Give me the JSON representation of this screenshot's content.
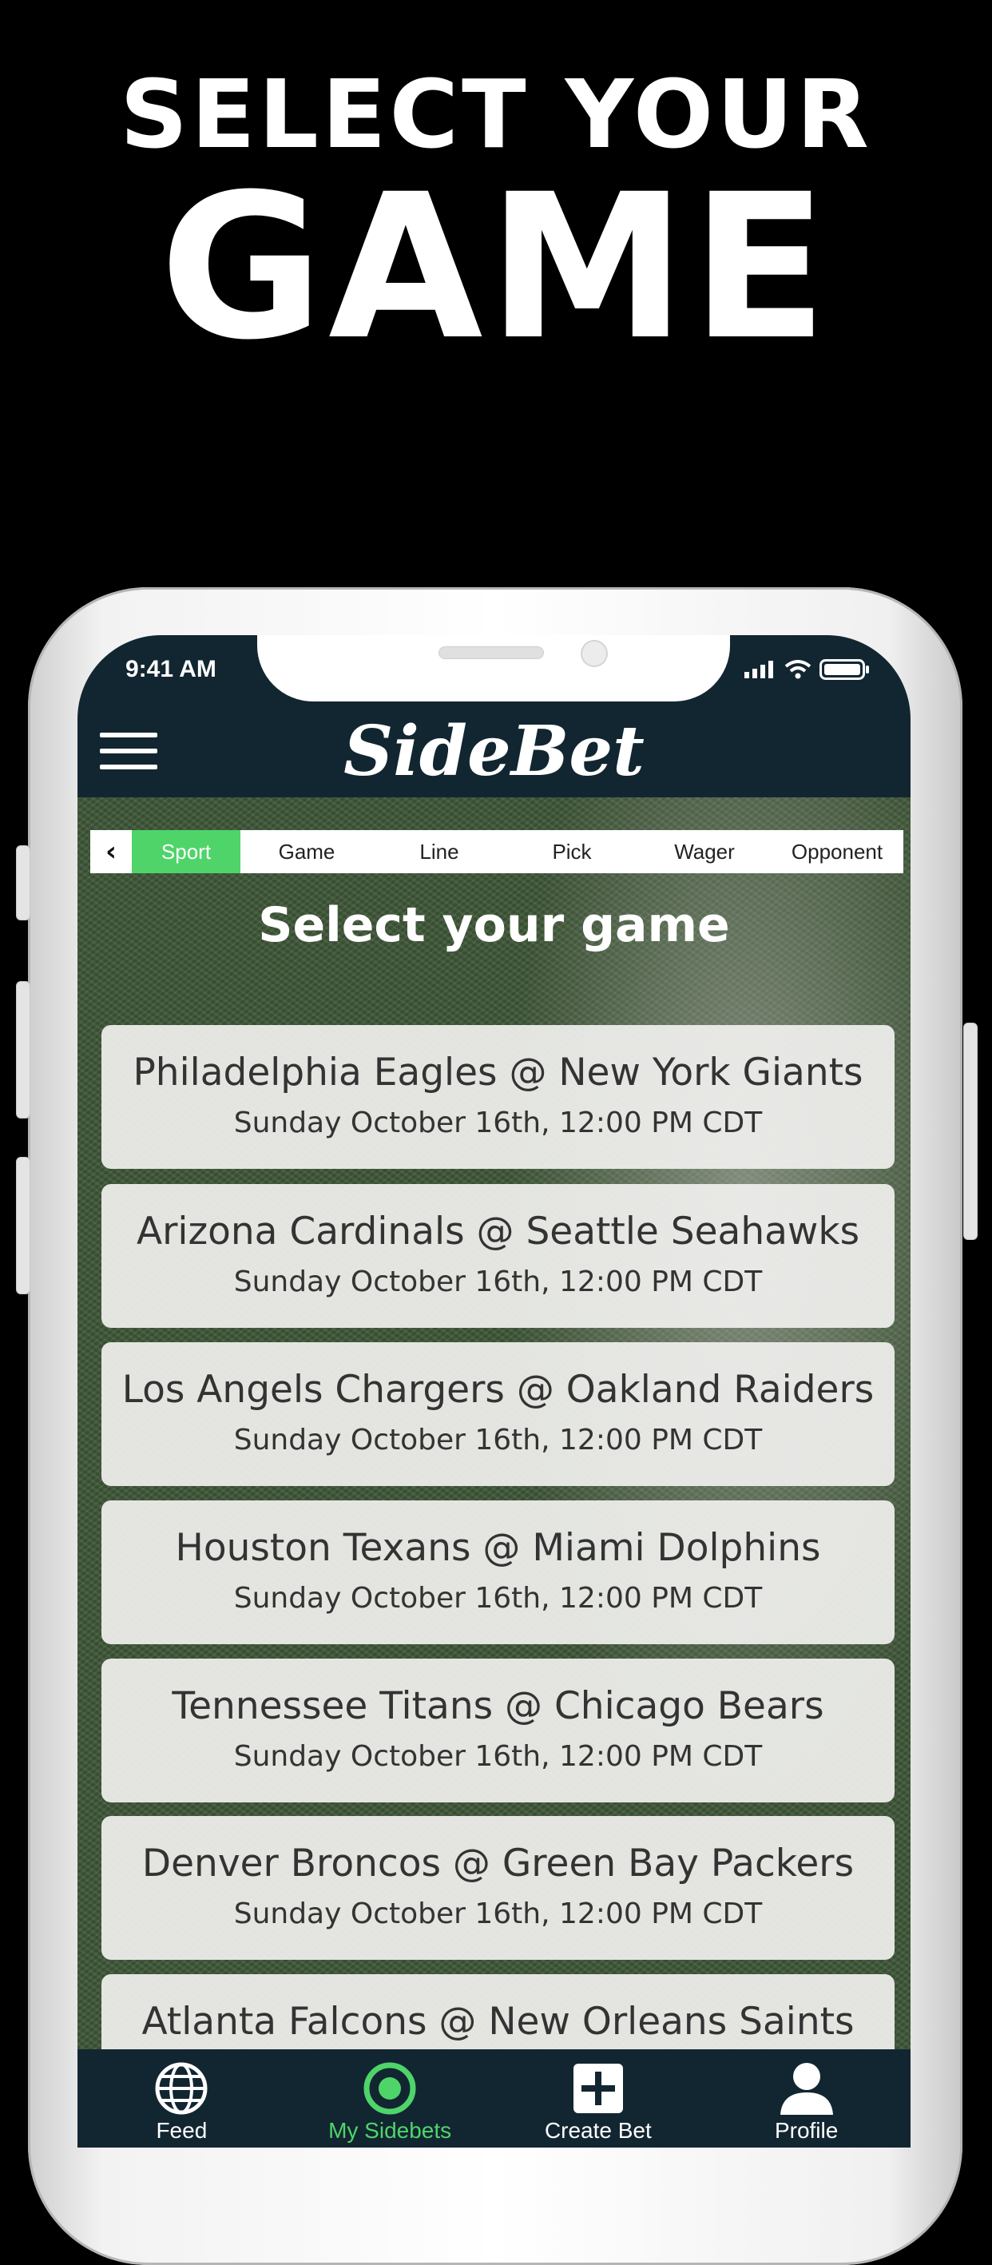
{
  "promo": {
    "line1": "SELECT YOUR",
    "line2": "GAME"
  },
  "status_bar": {
    "time": "9:41 AM"
  },
  "app": {
    "logo": "SideBet"
  },
  "steps": [
    "Sport",
    "Game",
    "Line",
    "Pick",
    "Wager",
    "Opponent"
  ],
  "active_step": "Sport",
  "screen_title": "Select your game",
  "games": [
    {
      "teams": "Philadelphia Eagles @ New York Giants",
      "date": "Sunday October 16th, 12:00 PM CDT"
    },
    {
      "teams": "Arizona Cardinals @ Seattle Seahawks",
      "date": "Sunday October 16th, 12:00 PM CDT"
    },
    {
      "teams": "Los Angels Chargers @ Oakland Raiders",
      "date": "Sunday October 16th, 12:00 PM CDT"
    },
    {
      "teams": "Houston Texans @ Miami Dolphins",
      "date": "Sunday October 16th, 12:00 PM CDT"
    },
    {
      "teams": "Tennessee Titans @ Chicago Bears",
      "date": "Sunday October 16th, 12:00 PM CDT"
    },
    {
      "teams": "Denver Broncos @ Green Bay Packers",
      "date": "Sunday October 16th, 12:00 PM CDT"
    },
    {
      "teams": "Atlanta Falcons @ New Orleans Saints",
      "date": ""
    }
  ],
  "tabbar": [
    {
      "label": "Feed",
      "icon": "globe-icon"
    },
    {
      "label": "My Sidebets",
      "icon": "target-icon"
    },
    {
      "label": "Create Bet",
      "icon": "plus-square-icon"
    },
    {
      "label": "Profile",
      "icon": "person-icon"
    }
  ],
  "active_tab": "My Sidebets",
  "colors": {
    "accent": "#4fd46a",
    "navy": "#122631",
    "card": "#f0f0ee"
  }
}
